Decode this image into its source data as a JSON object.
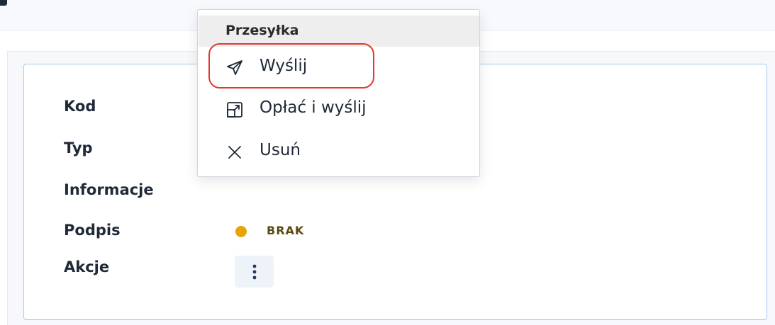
{
  "details": {
    "labels": {
      "kod": "Kod",
      "typ": "Typ",
      "informacje": "Informacje",
      "podpis": "Podpis",
      "akcje": "Akcje"
    },
    "podpis_status": "BRAK",
    "podpis_status_color": "#e5a50a",
    "akcje_button_icon": "kebab-vertical-icon"
  },
  "menu": {
    "header": "Przesyłka",
    "items": [
      {
        "label": "Wyślij",
        "icon": "send-icon",
        "highlighted": true
      },
      {
        "label": "Opłać i wyślij",
        "icon": "external-link-icon",
        "highlighted": false
      },
      {
        "label": "Usuń",
        "icon": "close-icon",
        "highlighted": false
      }
    ]
  },
  "colors": {
    "highlight": "#e0392e",
    "card_border": "#a9c9ec"
  }
}
